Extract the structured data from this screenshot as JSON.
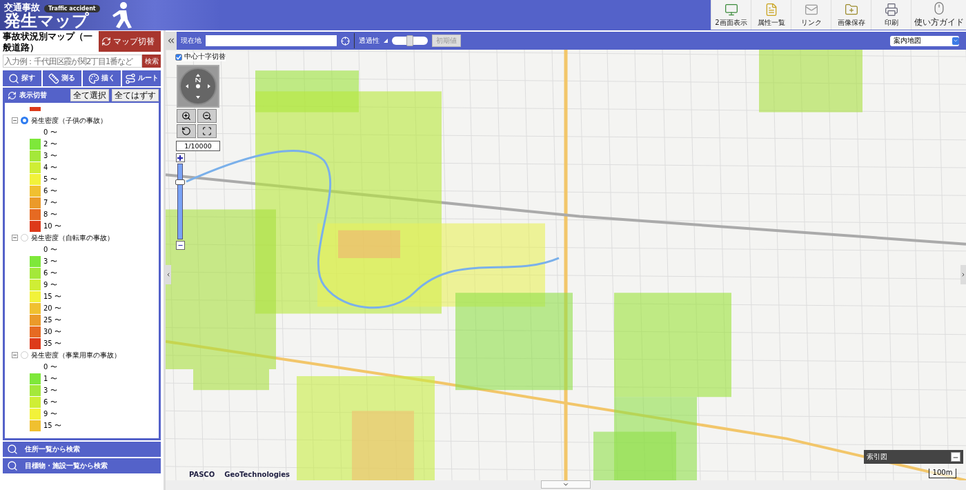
{
  "header": {
    "logo": {
      "title_small": "交通事故",
      "subtitle": "Traffic accident",
      "title": "発生マップ"
    },
    "tools": [
      {
        "label": "2画面表示"
      },
      {
        "label": "属性一覧"
      },
      {
        "label": "リンク"
      },
      {
        "label": "画像保存"
      },
      {
        "label": "印刷"
      },
      {
        "label": "使い方ガイド"
      }
    ]
  },
  "sidebar": {
    "title": "事故状況別マップ（一般道路）",
    "switch_button": "マップ切替",
    "search": {
      "placeholder": "入力例：千代田区霞が関2丁目1番など",
      "button": "検索"
    },
    "tool_tabs": [
      {
        "label": "探す"
      },
      {
        "label": "測る"
      },
      {
        "label": "描く"
      },
      {
        "label": "ルート"
      }
    ],
    "layer_panel": {
      "title": "表示切替",
      "buttons": [
        "全て選択",
        "全てはずす"
      ],
      "leading_items": [
        {
          "color": "#dd3a1a"
        }
      ],
      "groups": [
        {
          "name": "発生密度（子供の事故）",
          "selected": true,
          "expanded": true,
          "items": [
            {
              "label": "0 〜"
            },
            {
              "label": "2 〜",
              "color": "#7ee83a"
            },
            {
              "label": "3 〜",
              "color": "#a4e83a"
            },
            {
              "label": "4 〜",
              "color": "#cfee35"
            },
            {
              "label": "5 〜",
              "color": "#f2f23a"
            },
            {
              "label": "6 〜",
              "color": "#f0c030"
            },
            {
              "label": "7 〜",
              "color": "#eb9a2a"
            },
            {
              "label": "8 〜",
              "color": "#e66a22"
            },
            {
              "label": "10 〜",
              "color": "#dd3a1a"
            }
          ]
        },
        {
          "name": "発生密度（自転車の事故）",
          "selected": false,
          "expanded": true,
          "items": [
            {
              "label": "0 〜"
            },
            {
              "label": "3 〜",
              "color": "#7ee83a"
            },
            {
              "label": "6 〜",
              "color": "#a4e83a"
            },
            {
              "label": "9 〜",
              "color": "#cfee35"
            },
            {
              "label": "15 〜",
              "color": "#f2f23a"
            },
            {
              "label": "20 〜",
              "color": "#f0c030"
            },
            {
              "label": "25 〜",
              "color": "#eb9a2a"
            },
            {
              "label": "30 〜",
              "color": "#e66a22"
            },
            {
              "label": "35 〜",
              "color": "#dd3a1a"
            }
          ]
        },
        {
          "name": "発生密度（事業用車の事故）",
          "selected": false,
          "expanded": true,
          "items": [
            {
              "label": "0 〜"
            },
            {
              "label": "1 〜",
              "color": "#7ee83a"
            },
            {
              "label": "3 〜",
              "color": "#a4e83a"
            },
            {
              "label": "6 〜",
              "color": "#cfee35"
            },
            {
              "label": "9 〜",
              "color": "#f2f23a"
            },
            {
              "label": "15 〜",
              "color": "#f0c030"
            }
          ]
        }
      ]
    },
    "accordions": [
      "住所一覧から検索",
      "目標物・施設一覧から検索"
    ]
  },
  "toolbar": {
    "location_label": "現在地",
    "opacity_label": "透過性",
    "opacity": {
      "level": 0.5
    },
    "reset_button": {
      "label": "初期値",
      "disabled": true
    },
    "base_map": "案内地図"
  },
  "map": {
    "center_cross": {
      "label": "中心十字切替",
      "checked": true
    },
    "scale": "1/10000",
    "zoom": {
      "level": 0.76
    },
    "index_map": {
      "title": "索引図"
    },
    "scale_bar": "100m",
    "credits": [
      "PASCO",
      "GeoTechnologies"
    ]
  }
}
